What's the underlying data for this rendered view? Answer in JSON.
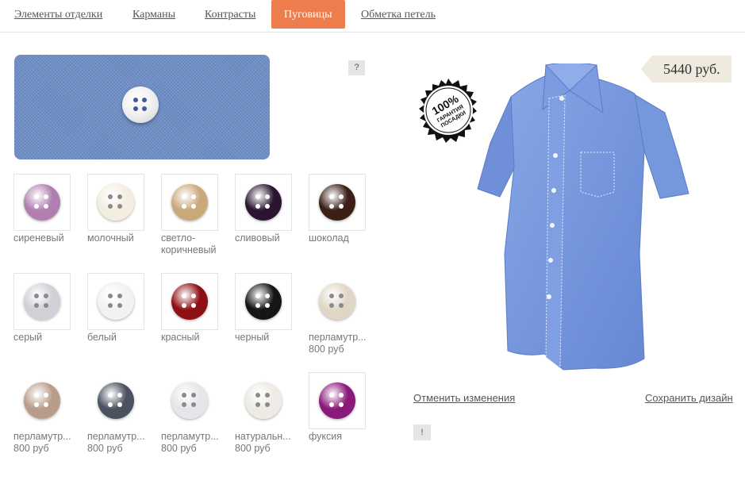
{
  "tabs": [
    {
      "label": "Элементы отделки"
    },
    {
      "label": "Карманы"
    },
    {
      "label": "Контрасты"
    },
    {
      "label": "Пуговицы",
      "active": true
    },
    {
      "label": "Обметка петель"
    }
  ],
  "help_label": "?",
  "info_label": "!",
  "price": "5440 руб.",
  "guarantee": {
    "line1": "100%",
    "line2": "ГАРАНТИЯ",
    "line3": "ПОСАДКИ"
  },
  "buttons": [
    {
      "name": "сиреневый",
      "price": "",
      "color": "#b07fb0"
    },
    {
      "name": "молочный",
      "price": "",
      "color": "#f4eee0"
    },
    {
      "name": "светло-коричневый",
      "price": "",
      "color": "#c9a87a"
    },
    {
      "name": "сливовый",
      "price": "",
      "color": "#2a1430"
    },
    {
      "name": "шоколад",
      "price": "",
      "color": "#3a1f17"
    },
    {
      "name": "серый",
      "price": "",
      "color": "#d0d0d6"
    },
    {
      "name": "белый",
      "price": "",
      "color": "#f2f2f0"
    },
    {
      "name": "красный",
      "price": "",
      "color": "#8e1015"
    },
    {
      "name": "черный",
      "price": "",
      "color": "#151515"
    },
    {
      "name": "перламутр...",
      "price": "800 руб",
      "color": "#e0d6c6"
    },
    {
      "name": "перламутр...",
      "price": "800 руб",
      "color": "#b89c8a"
    },
    {
      "name": "перламутр...",
      "price": "800 руб",
      "color": "#4a5260"
    },
    {
      "name": "перламутр...",
      "price": "800 руб",
      "color": "#e6e6ea"
    },
    {
      "name": "натуральн...",
      "price": "800 руб",
      "color": "#eeeae4"
    },
    {
      "name": "фуксия",
      "price": "",
      "color": "#8a1a7a"
    }
  ],
  "actions": {
    "cancel": "Отменить изменения",
    "save": "Сохранить дизайн"
  },
  "colors": {
    "accent": "#ee7d4e",
    "shirt": "#7a9be0",
    "fabric": "#6f8fc4"
  }
}
